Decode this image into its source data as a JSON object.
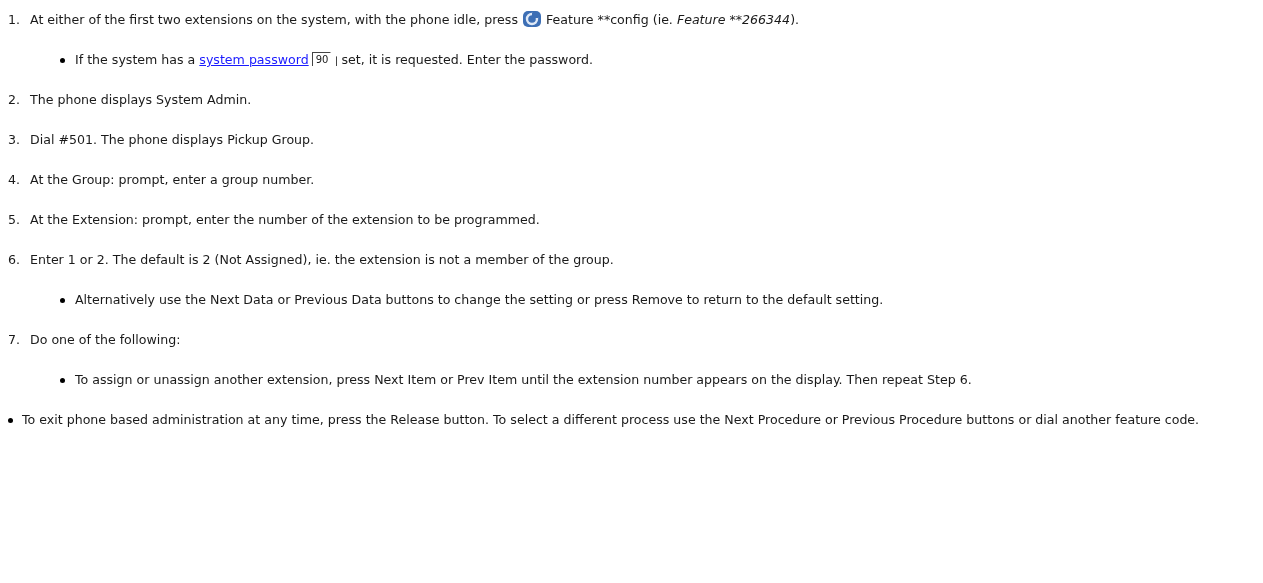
{
  "items": [
    {
      "kind": "step",
      "number": "1.",
      "segments": [
        {
          "kind": "text",
          "text": "At either of the first two extensions on the system, with the phone idle, press "
        },
        {
          "kind": "icon"
        },
        {
          "kind": "text",
          "text": " Feature **config (ie. "
        },
        {
          "kind": "italic",
          "text": "Feature **266344"
        },
        {
          "kind": "text",
          "text": ")."
        }
      ],
      "children": [
        {
          "kind": "bullet",
          "segments": [
            {
              "kind": "text",
              "text": "If the system has a "
            },
            {
              "kind": "link",
              "text": "system password"
            },
            {
              "kind": "pageref",
              "text": "90"
            },
            {
              "kind": "text",
              "text": " set, it is requested. Enter the password."
            }
          ]
        }
      ]
    },
    {
      "kind": "step",
      "number": "2.",
      "segments": [
        {
          "kind": "text",
          "text": "The phone displays System Admin."
        }
      ]
    },
    {
      "kind": "step",
      "number": "3.",
      "segments": [
        {
          "kind": "text",
          "text": "Dial #501. The phone displays Pickup Group."
        }
      ]
    },
    {
      "kind": "step",
      "number": "4.",
      "segments": [
        {
          "kind": "text",
          "text": "At the Group: prompt, enter a group number."
        }
      ]
    },
    {
      "kind": "step",
      "number": "5.",
      "segments": [
        {
          "kind": "text",
          "text": "At the Extension: prompt, enter the number of the extension to be programmed."
        }
      ]
    },
    {
      "kind": "step",
      "number": "6.",
      "segments": [
        {
          "kind": "text",
          "text": "Enter 1 or 2. The default is 2 (Not Assigned), ie. the extension is not a member of the group."
        }
      ],
      "children": [
        {
          "kind": "bullet",
          "segments": [
            {
              "kind": "text",
              "text": "Alternatively use the Next Data or Previous Data buttons to change the setting or press Remove to return to the default setting."
            }
          ]
        }
      ]
    },
    {
      "kind": "step",
      "number": "7.",
      "segments": [
        {
          "kind": "text",
          "text": "Do one of the following:"
        }
      ],
      "children": [
        {
          "kind": "bullet",
          "segments": [
            {
              "kind": "text",
              "text": "To assign or unassign another extension, press Next Item or Prev Item until the extension number appears on the display. Then repeat Step 6."
            }
          ]
        }
      ]
    },
    {
      "kind": "bullet",
      "segments": [
        {
          "kind": "text",
          "text": "To exit phone based administration at any time, press the Release button. To select a different process use the Next Procedure or Previous Procedure buttons or dial another feature code."
        }
      ]
    }
  ]
}
